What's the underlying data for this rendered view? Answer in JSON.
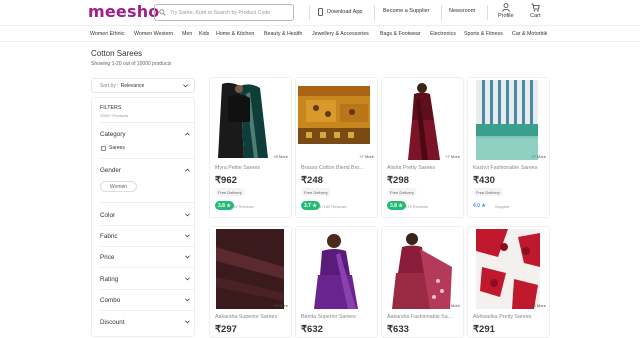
{
  "header": {
    "logo": "meesho",
    "search_placeholder": "Try Saree, Kurti or Search by Product Code",
    "download_app": "Download App",
    "become_supplier": "Become a Supplier",
    "newsroom": "Newsroom",
    "profile": "Profile",
    "cart": "Cart"
  },
  "categories": [
    "Women Ethnic",
    "Women Western",
    "Men",
    "Kids",
    "Home & Kitchen",
    "Beauty & Health",
    "Jewellery & Accessories",
    "Bags & Footwear",
    "Electronics",
    "Sports & Fitness",
    "Car & Motorbik"
  ],
  "page": {
    "title": "Cotton Sarees",
    "subtitle": "Showing 1-20 out of 10000 products"
  },
  "sort": {
    "label": "Sort by :",
    "value": "Relevance"
  },
  "filters": {
    "title": "FILTERS",
    "subtitle": "1000+ Products",
    "category": "Category",
    "category_option": "Sarees",
    "gender": "Gender",
    "gender_option": "Women",
    "sections": [
      "Color",
      "Fabric",
      "Price",
      "Rating",
      "Combo",
      "Discount"
    ]
  },
  "products": [
    {
      "name": "Myra Petite Sarees",
      "price": "₹962",
      "more": "+8 More",
      "delivery": "Free Delivery",
      "rating": "3.8 ★",
      "reviews": "94 Reviews",
      "rating_color": "#23bb75"
    },
    {
      "name": "Brasso Cotton Blend Bro...",
      "price": "₹248",
      "more": "+7 More",
      "delivery": "Free Delivery",
      "rating": "3.7 ★",
      "reviews": "87183 Reviews",
      "rating_color": "#23bb75"
    },
    {
      "name": "Alisha Pretty Sarees",
      "price": "₹298",
      "more": "+7 More",
      "delivery": "Free Delivery",
      "rating": "3.8 ★",
      "reviews": "973 Reviews",
      "rating_color": "#23bb75"
    },
    {
      "name": "Kashvi Fashionable Sarees",
      "price": "₹430",
      "more": "+7 More",
      "delivery": "Free Delivery",
      "rating": "4.0 ★",
      "reviews": "Supplier",
      "rating_color": "#5a8dee"
    },
    {
      "name": "Aakarsha Superior Sarees",
      "price": "₹297",
      "more": "+5 More"
    },
    {
      "name": "Banita Superior Sarees",
      "price": "₹632",
      "more": ""
    },
    {
      "name": "Aakarsha Fashionable Sa...",
      "price": "₹633",
      "more": "+2 More"
    },
    {
      "name": "Abhisarika Pretty Sarees",
      "price": "₹291",
      "more": "+6 More"
    }
  ]
}
